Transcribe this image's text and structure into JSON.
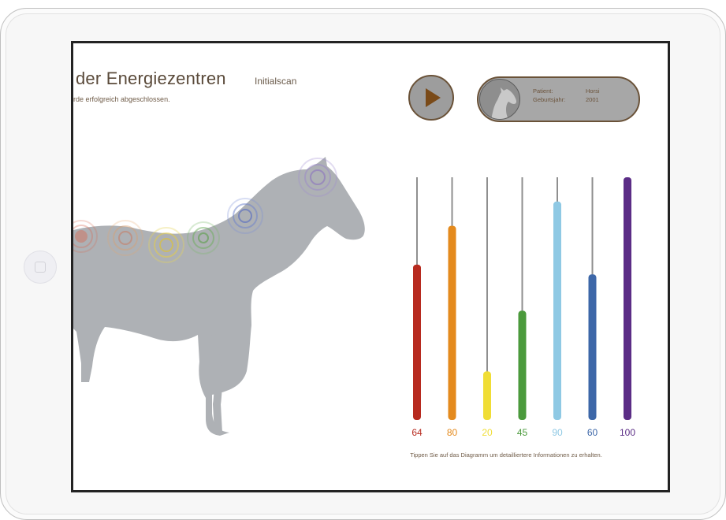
{
  "header": {
    "title": "der Energiezentren",
    "subtitle": "Initialscan",
    "status": "rde erfolgreich abgeschlossen."
  },
  "patient": {
    "label_patient": "Patient:",
    "value_patient": "Horsi",
    "label_birth": "Geburtsjahr:",
    "value_birth": "2001",
    "avatar_icon": "horse-head-icon"
  },
  "controls": {
    "play_icon": "play-icon"
  },
  "chart_data": {
    "type": "bar",
    "categories": [
      "",
      "",
      "",
      "",
      "",
      "",
      ""
    ],
    "values": [
      64,
      80,
      20,
      45,
      90,
      60,
      100
    ],
    "labels": [
      "64",
      "80",
      "20",
      "45",
      "90",
      "60",
      "100"
    ],
    "colors": [
      "#b72a1f",
      "#e48a1d",
      "#f0dd35",
      "#4b9a3c",
      "#8fc9e4",
      "#3d67a8",
      "#5b2d86"
    ],
    "ylim": [
      0,
      100
    ]
  },
  "footer": {
    "hint": "Tippen Sie auf das Diagramm um detailliertere Informationen zu erhalten."
  }
}
